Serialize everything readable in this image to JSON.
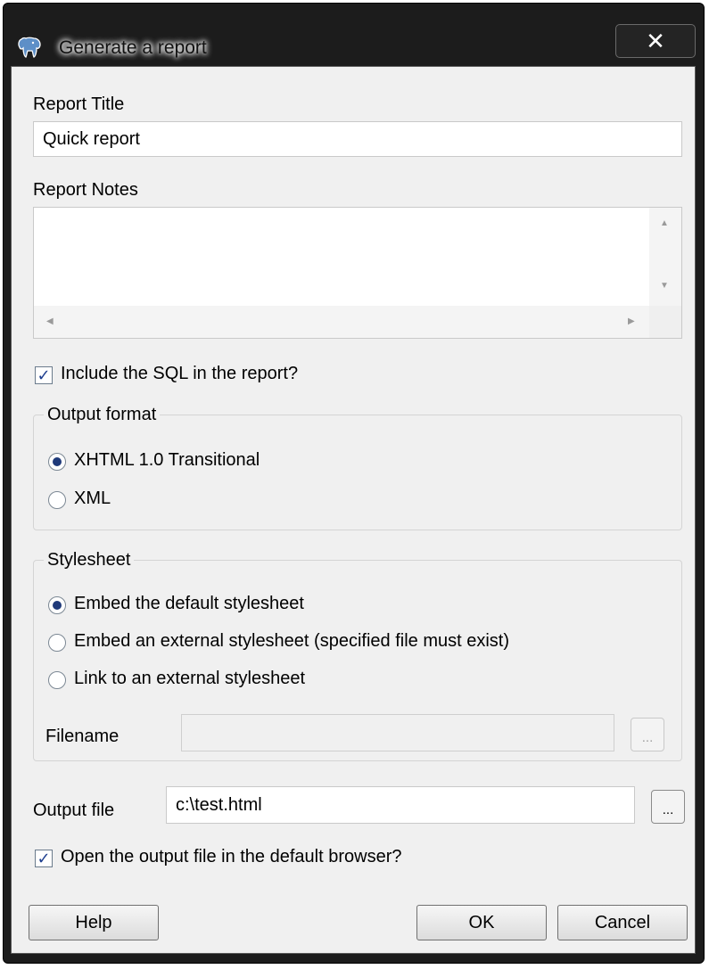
{
  "window": {
    "title": "Generate a report",
    "close_symbol": "✕",
    "app_icon": "elephant-icon"
  },
  "report_title": {
    "label": "Report Title",
    "value": "Quick report"
  },
  "report_notes": {
    "label": "Report Notes",
    "value": ""
  },
  "include_sql": {
    "label": "Include the SQL in the report?",
    "checked": true
  },
  "output_format": {
    "legend": "Output format",
    "options": [
      "XHTML 1.0 Transitional",
      "XML"
    ],
    "selected": "XHTML 1.0 Transitional"
  },
  "stylesheet": {
    "legend": "Stylesheet",
    "options": [
      "Embed the default stylesheet",
      "Embed an external stylesheet (specified file must exist)",
      "Link to an external stylesheet"
    ],
    "selected": "Embed the default stylesheet",
    "filename_label": "Filename",
    "filename_value": "",
    "browse_label": "..."
  },
  "output_file": {
    "label": "Output file",
    "value": "c:\\test.html",
    "browse_label": "..."
  },
  "open_browser": {
    "label": "Open the output file in the default browser?",
    "checked": true
  },
  "buttons": {
    "help": "Help",
    "ok": "OK",
    "cancel": "Cancel"
  },
  "colors": {
    "frame": "#1c1c1c",
    "client": "#f0f0f0",
    "check": "#1f3f8f"
  }
}
